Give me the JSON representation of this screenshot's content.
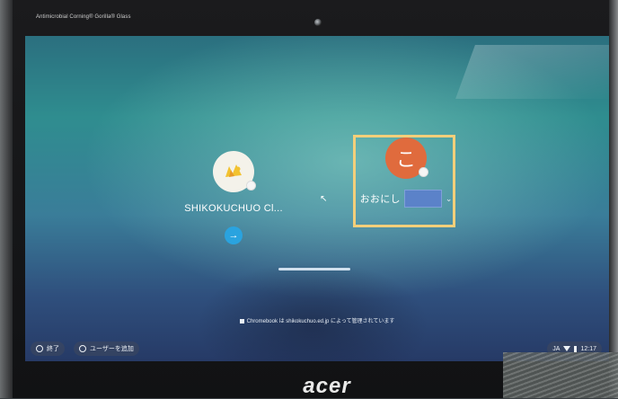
{
  "device": {
    "glass_label": "Antimicrobial Corning® Gorilla® Glass",
    "brand": "acer"
  },
  "login": {
    "pods": [
      {
        "name": "SHIKOKUCHUO Cl...",
        "avatar_icon": "school-mascot-icon"
      },
      {
        "name": "おおにし",
        "avatar_letter": "こ",
        "avatar_color": "#e06b3d"
      }
    ],
    "next_arrow": "→",
    "user_dropdown": "⌄"
  },
  "managed_note": "Chromebook は shikokuchuo.ed.jp によって管理されています",
  "shelf": {
    "shutdown_label": "終了",
    "add_user_label": "ユーザーを追加"
  },
  "tray": {
    "ime": "JA",
    "time": "12:17"
  },
  "colors": {
    "accent_blue": "#2aa3df",
    "highlight_frame": "#f3cf7a",
    "avatar_orange": "#e06b3d"
  }
}
